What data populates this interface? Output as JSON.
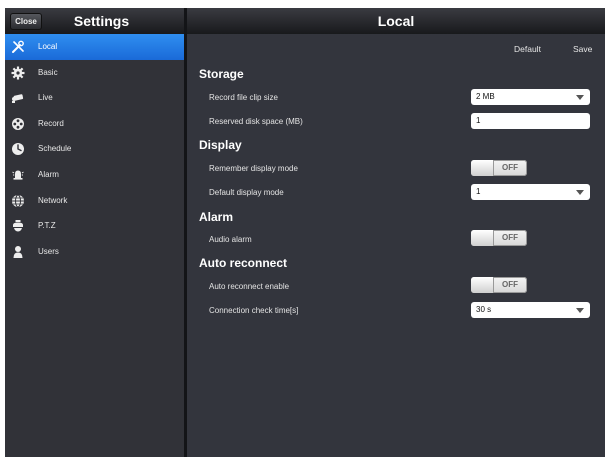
{
  "sidebar": {
    "close_label": "Close",
    "title": "Settings",
    "items": [
      {
        "label": "Local",
        "icon": "tools-icon",
        "active": true
      },
      {
        "label": "Basic",
        "icon": "gear-icon",
        "active": false
      },
      {
        "label": "Live",
        "icon": "camera-icon",
        "active": false
      },
      {
        "label": "Record",
        "icon": "film-reel-icon",
        "active": false
      },
      {
        "label": "Schedule",
        "icon": "clock-icon",
        "active": false
      },
      {
        "label": "Alarm",
        "icon": "alarm-bell-icon",
        "active": false
      },
      {
        "label": "Network",
        "icon": "globe-icon",
        "active": false
      },
      {
        "label": "P.T.Z",
        "icon": "ptz-camera-icon",
        "active": false
      },
      {
        "label": "Users",
        "icon": "user-icon",
        "active": false
      }
    ]
  },
  "main": {
    "title": "Local",
    "toolbar": {
      "default_label": "Default",
      "save_label": "Save"
    },
    "storage": {
      "title": "Storage",
      "record_file_size_label": "Record file clip size",
      "record_file_size_value": "2 MB",
      "reserved_space_label": "Reserved disk space (MB)",
      "reserved_space_value": "1"
    },
    "display": {
      "title": "Display",
      "remember_mode_label": "Remember display mode",
      "remember_mode_state": "OFF",
      "default_mode_label": "Default display mode",
      "default_mode_value": "1"
    },
    "alarm": {
      "title": "Alarm",
      "audio_alarm_label": "Audio alarm",
      "audio_alarm_state": "OFF"
    },
    "auto_reconnect": {
      "title": "Auto reconnect",
      "enable_label": "Auto reconnect enable",
      "enable_state": "OFF",
      "check_time_label": "Connection check time[s]",
      "check_time_value": "30 s"
    }
  },
  "colors": {
    "accent": "#1f78e6",
    "background": "#33353d",
    "sidebar": "#313238"
  }
}
